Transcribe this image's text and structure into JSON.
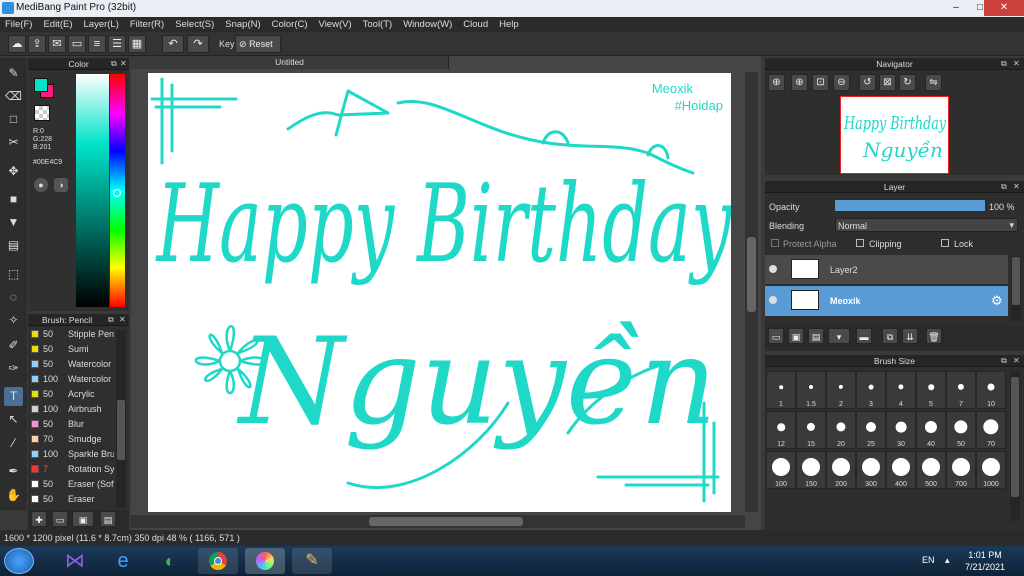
{
  "window": {
    "title": "MediBang Paint Pro (32bit)",
    "min": "–",
    "max": "□",
    "close": "✕"
  },
  "menu": [
    "File(F)",
    "Edit(E)",
    "Layer(L)",
    "Filter(R)",
    "Select(S)",
    "Snap(N)",
    "Color(C)",
    "View(V)",
    "Tool(T)",
    "Window(W)",
    "Cloud",
    "Help"
  ],
  "toolbar": {
    "key_label": "Key",
    "reset_label": "Reset"
  },
  "color_panel": {
    "title": "Color",
    "r": "R:0",
    "g": "G:228",
    "b": "B:201",
    "hex": "#00E4C9",
    "fg": "#00e4c9",
    "bg": "#ff1a80"
  },
  "brush_panel": {
    "title": "Brush: Pencil",
    "items": [
      {
        "size": "50",
        "name": "Stipple Pen",
        "color": "#e8e000"
      },
      {
        "size": "50",
        "name": "Sumi",
        "color": "#e8e000"
      },
      {
        "size": "50",
        "name": "Watercolor",
        "color": "#8fd0ff"
      },
      {
        "size": "100",
        "name": "Watercolor",
        "color": "#8fd0ff"
      },
      {
        "size": "50",
        "name": "Acrylic",
        "color": "#e8e000"
      },
      {
        "size": "100",
        "name": "Airbrush",
        "color": "#cfcfcf"
      },
      {
        "size": "50",
        "name": "Blur",
        "color": "#ff8fd0"
      },
      {
        "size": "70",
        "name": "Smudge",
        "color": "#ffd0a0"
      },
      {
        "size": "100",
        "name": "Sparkle Brush",
        "color": "#8fd0ff"
      },
      {
        "size": "7",
        "name": "Rotation Sy",
        "color": "#ff3030"
      },
      {
        "size": "50",
        "name": "Eraser (Soft)",
        "color": "#ffffff"
      },
      {
        "size": "50",
        "name": "Eraser",
        "color": "#ffffff"
      }
    ]
  },
  "document": {
    "tab": "Untitled"
  },
  "canvas_text": {
    "watermark1": "Meoxik",
    "watermark2": "#Hoidap",
    "line1": "Happy Birthday",
    "line2": "Nguyền",
    "ink": "#1fd8c8"
  },
  "navigator": {
    "title": "Navigator"
  },
  "layer_panel": {
    "title": "Layer",
    "opacity_label": "Opacity",
    "opacity_value": "100 %",
    "opacity_fraction": 1.0,
    "blending_label": "Blending",
    "blending_value": "Normal",
    "protect_alpha": "Protect Alpha",
    "clipping": "Clipping",
    "lock": "Lock",
    "layers": [
      {
        "name": "Layer2",
        "selected": false
      },
      {
        "name": "Meoxik",
        "selected": true
      }
    ]
  },
  "brush_size": {
    "title": "Brush Size",
    "sizes": [
      "1",
      "1.5",
      "2",
      "3",
      "4",
      "5",
      "7",
      "10",
      "12",
      "15",
      "20",
      "25",
      "30",
      "40",
      "50",
      "70",
      "100",
      "150",
      "200",
      "300",
      "400",
      "500",
      "700",
      "1000"
    ]
  },
  "status": {
    "text": "1600 * 1200 pixel   (11.6 * 8.7cm)   350 dpi   48 %   ( 1166, 571 )"
  },
  "taskbar": {
    "lang": "EN",
    "time": "1:01 PM",
    "date": "7/21/2021"
  }
}
